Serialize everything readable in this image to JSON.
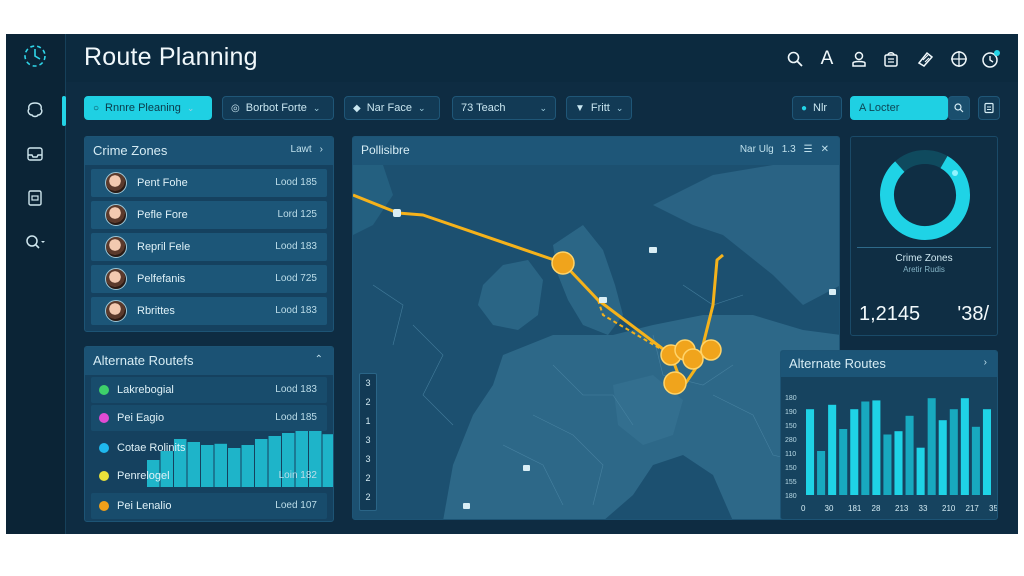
{
  "app": {
    "title": "Route Planning",
    "accent": "#23d3e6",
    "route_color": "#f5b21b"
  },
  "sidebar": {
    "items": [
      {
        "icon": "brain-icon"
      },
      {
        "icon": "inbox-icon"
      },
      {
        "icon": "document-icon"
      },
      {
        "icon": "search-icon"
      }
    ]
  },
  "header": {
    "icons": [
      "search-icon",
      "font-icon",
      "user-icon",
      "bag-icon",
      "tag-icon",
      "target-icon",
      "clock-icon"
    ],
    "font_glyph": "A"
  },
  "toolbar": {
    "items": [
      {
        "label": "Rnnre Pleaning",
        "active": true
      },
      {
        "label": "Borbot Forte",
        "active": false
      },
      {
        "label": "Nar Face",
        "active": false
      },
      {
        "label": "73 Teach",
        "active": false
      },
      {
        "label": "Fritt",
        "active": false
      }
    ],
    "filter_label": "Nlr",
    "search_value": "A Locter"
  },
  "crime_zones": {
    "title": "Crime Zones",
    "header_value": "Lawt",
    "rows": [
      {
        "label": "Pent Fohe",
        "value": "Lood 185"
      },
      {
        "label": "Pefle Fore",
        "value": "Lord 125"
      },
      {
        "label": "Repril Fele",
        "value": "Lood 183"
      },
      {
        "label": "Pelfefanis",
        "value": "Lood 725"
      },
      {
        "label": "Rbrittes",
        "value": "Lood 183"
      }
    ]
  },
  "alternate_list": {
    "title": "Alternate Routefs",
    "rows": [
      {
        "label": "Lakrebogial",
        "value": "Lood 183",
        "color": "#3ed06a"
      },
      {
        "label": "Pei Eagio",
        "value": "Lood 185",
        "color": "#e04bd4"
      },
      {
        "label": "Cotae Rolinits",
        "value": "Lood 185",
        "color": "#1fb8ee"
      },
      {
        "label": "Penrelogel",
        "value": "Loin 182",
        "color": "#e9e13a"
      },
      {
        "label": "Pei Lenalio",
        "value": "Loed 107",
        "color": "#f0a01a"
      }
    ],
    "bar_levels": [
      0.45,
      0.6,
      0.8,
      0.75,
      0.7,
      0.72,
      0.65,
      0.7,
      0.8,
      0.85,
      0.9,
      1.0,
      0.95,
      0.88
    ]
  },
  "map": {
    "title": "Pollisibre",
    "header_value": "Nar Ulg",
    "header_num": "1.3",
    "zoom_labels": [
      "3",
      "2",
      "1",
      "3",
      "3",
      "2",
      "2"
    ]
  },
  "stats": {
    "donut_label": "Crime Zones",
    "donut_sublabel": "Aretir Rudis",
    "donut_fill": 0.8,
    "value_left": "1,2145",
    "value_right": "'38/"
  },
  "alt_chart": {
    "title": "Alternate Routes",
    "y_ticks": [
      "180",
      "190",
      "150",
      "280",
      "110",
      "150",
      "155",
      "180"
    ],
    "x_ticks": [
      "0",
      "30",
      "181",
      "28",
      "213",
      "33",
      "210",
      "217",
      "35"
    ],
    "levels": [
      0.78,
      0.4,
      0.82,
      0.6,
      0.78,
      0.85,
      0.86,
      0.55,
      0.58,
      0.72,
      0.43,
      0.88,
      0.68,
      0.78,
      0.88,
      0.62,
      0.78
    ]
  }
}
